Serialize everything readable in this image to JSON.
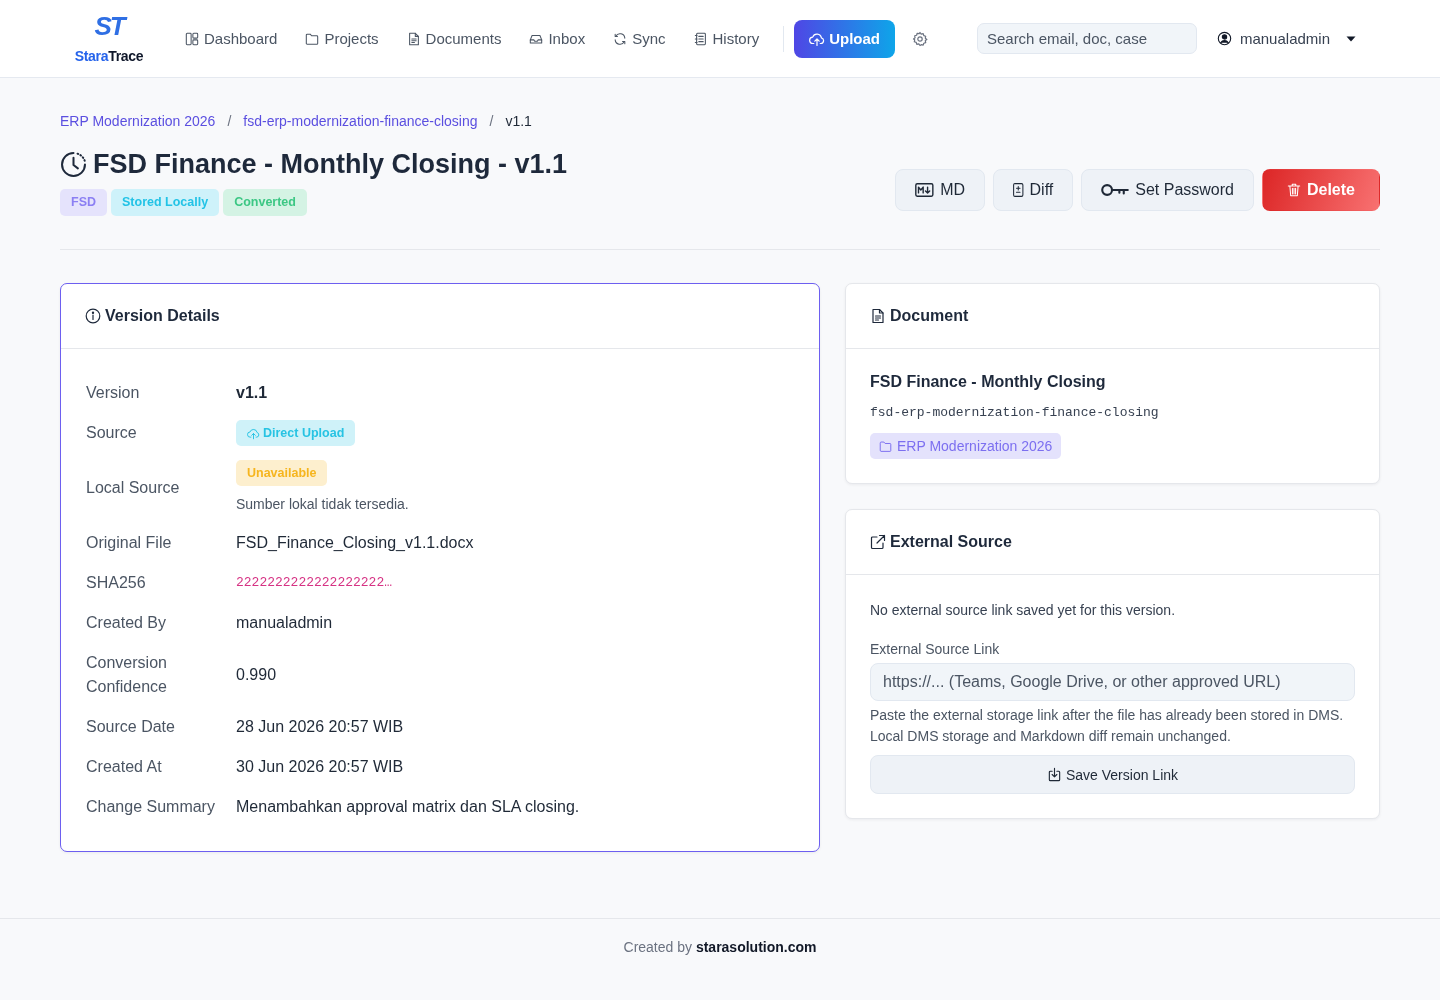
{
  "nav": {
    "logo": {
      "mark": "ST",
      "name_start": "Stara",
      "name_end": "Trace"
    },
    "items": [
      {
        "label": "Dashboard"
      },
      {
        "label": "Projects"
      },
      {
        "label": "Documents"
      },
      {
        "label": "Inbox"
      },
      {
        "label": "Sync"
      },
      {
        "label": "History"
      }
    ],
    "upload_button": "Upload",
    "search": {
      "placeholder": "Search email, doc, case"
    },
    "user": "manualadmin"
  },
  "breadcrumb": [
    {
      "label": "ERP Modernization 2026",
      "current": false,
      "separator": "/"
    },
    {
      "label": "fsd-erp-modernization-finance-closing",
      "current": false,
      "separator": "/"
    },
    {
      "label": "v1.1",
      "current": true
    }
  ],
  "title": "FSD Finance - Monthly Closing - v1.1",
  "tags": [
    {
      "label": "FSD",
      "color": "#8b7ff3"
    },
    {
      "label": "Stored Locally",
      "color": "#22c3e6"
    },
    {
      "label": "Converted",
      "color": "#3cc784"
    }
  ],
  "actions": [
    {
      "label": "MD",
      "kind": "secondary"
    },
    {
      "label": "Diff",
      "kind": "secondary"
    },
    {
      "label": "Set Password",
      "kind": "secondary"
    },
    {
      "label": "Delete",
      "kind": "danger"
    }
  ],
  "version_details": {
    "title": "Version Details",
    "highlighted": true,
    "rows": [
      {
        "label": "Version",
        "kind": "strong",
        "value": "v1.1"
      },
      {
        "label": "Source",
        "kind": "icon_badge",
        "value": "Direct Upload",
        "color": "#27c3e3"
      },
      {
        "label": "Local Source",
        "kind": "badge",
        "value": "Unavailable",
        "color": "#f6b51e",
        "note": "Sumber lokal tidak tersedia."
      },
      {
        "label": "Original File",
        "kind": "text",
        "value": "FSD_Finance_Closing_v1.1.docx"
      },
      {
        "label": "SHA256",
        "kind": "code",
        "value": "2222222222222222222…"
      },
      {
        "label": "Created By",
        "kind": "text",
        "value": "manualadmin"
      },
      {
        "label": "Conversion Confidence",
        "kind": "text",
        "value": "0.990"
      },
      {
        "label": "Source Date",
        "kind": "text",
        "value": "28 Jun 2026 20:57 WIB"
      },
      {
        "label": "Created At",
        "kind": "text",
        "value": "30 Jun 2026 20:57 WIB"
      },
      {
        "label": "Change Summary",
        "kind": "text",
        "value": "Menambahkan approval matrix dan SLA closing."
      }
    ]
  },
  "document": {
    "title": "Document",
    "name": "FSD Finance - Monthly Closing",
    "slug": "fsd-erp-modernization-finance-closing",
    "project": "ERP Modernization 2026"
  },
  "external_source": {
    "title": "External Source",
    "message": "No external source link saved yet for this version.",
    "field": {
      "label": "External Source Link",
      "placeholder": "https://... (Teams, Google Drive, or other approved URL)"
    },
    "help": "Paste the external storage link after the file has already been stored in DMS. Local DMS storage and Markdown diff remain unchanged.",
    "button": "Save Version Link"
  },
  "footer": {
    "text": "Created by **starasolution.com**"
  }
}
